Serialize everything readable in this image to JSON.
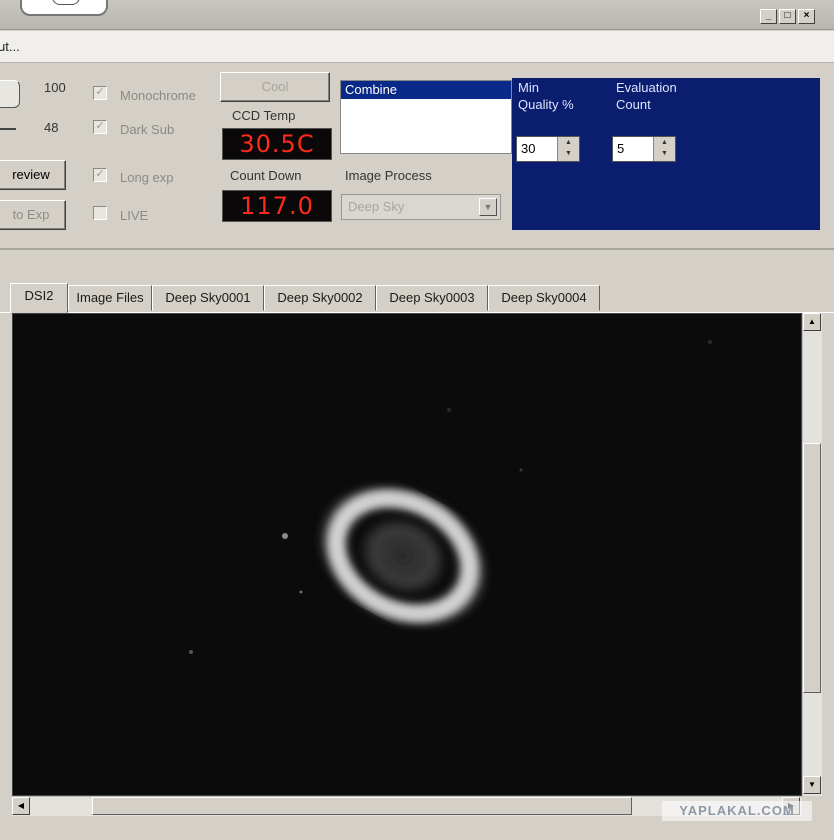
{
  "menu": {
    "item": "ut..."
  },
  "window_buttons": {
    "minimize": "_",
    "maximize": "□",
    "close": "×"
  },
  "controls": {
    "value_top": "100",
    "value_bottom": "48",
    "preview_label": "review",
    "autoexp_label": "to Exp",
    "monochrome_label": "Monochrome",
    "darksub_label": "Dark Sub",
    "longexp_label": "Long exp",
    "live_label": "LIVE",
    "cool_button": "Cool",
    "ccd_temp_label": "CCD Temp",
    "ccd_temp_value": "30.5C",
    "countdown_label": "Count Down",
    "countdown_value": "117.0",
    "combine_item": "Combine",
    "image_process_label": "Image Process",
    "image_process_value": "Deep Sky",
    "min_quality_label_1": "Min",
    "min_quality_label_2": "Quality %",
    "min_quality_value": "30",
    "eval_count_label_1": "Evaluation",
    "eval_count_label_2": "Count",
    "eval_count_value": "5"
  },
  "tabs": [
    {
      "label": "DSI2"
    },
    {
      "label": "Image Files"
    },
    {
      "label": "Deep Sky0001"
    },
    {
      "label": "Deep Sky0002"
    },
    {
      "label": "Deep Sky0003"
    },
    {
      "label": "Deep Sky0004"
    }
  ],
  "watermark": "YAPLAKAL.COM",
  "colors": {
    "panel_bg": "#d4d0c8",
    "blue_panel": "#0a1d6e",
    "led_text": "#ff2a1a",
    "image_bg": "#0b0b0b"
  }
}
